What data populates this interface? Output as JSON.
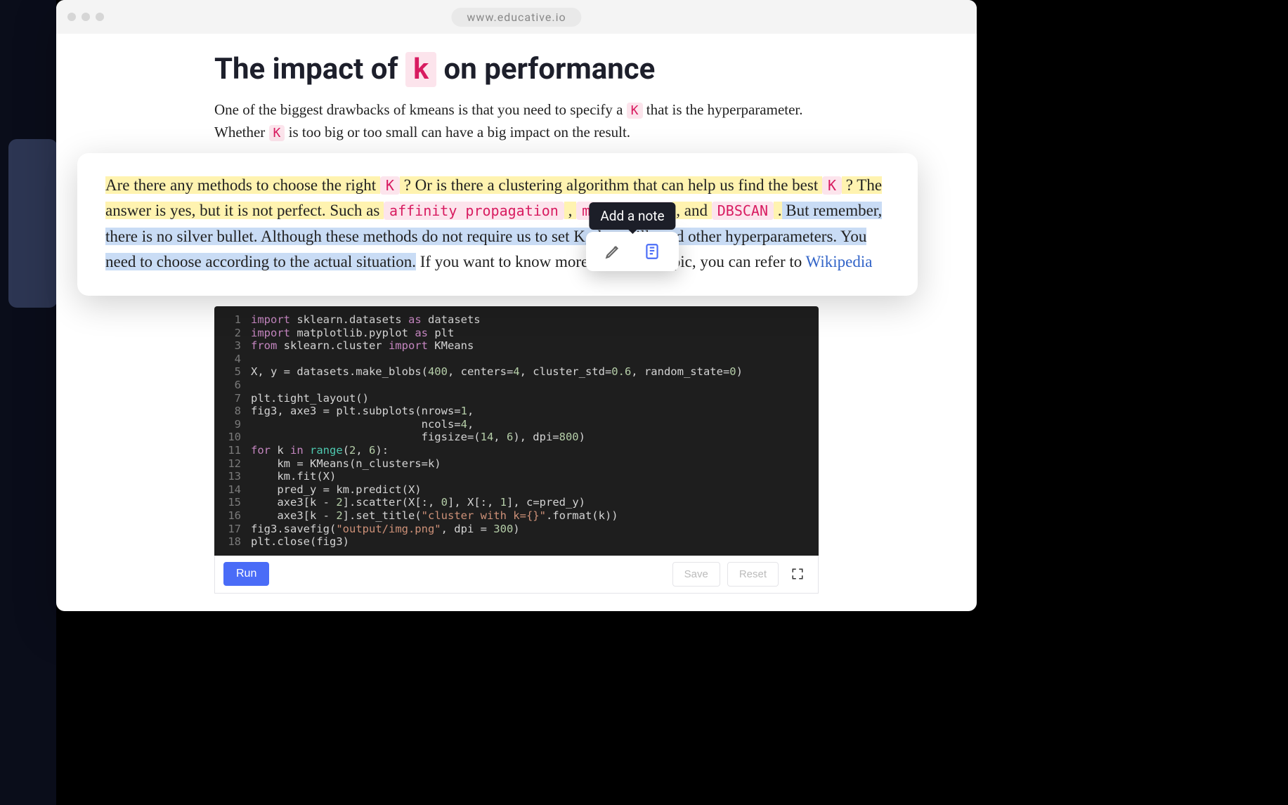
{
  "browser": {
    "url": "www.educative.io"
  },
  "heading": {
    "pre": "The impact of ",
    "code": "k",
    "post": " on performance"
  },
  "para1": {
    "t1": "One of the biggest drawbacks of kmeans is that you need to specify a ",
    "k1": "K",
    "t2": " that is the hyperparameter. Whether ",
    "k2": "K",
    "t3": " is too big or too small can have a big impact on the result."
  },
  "float": {
    "y1": "Are there any methods to choose the right ",
    "kA": "K",
    "y2": " ? Or is there a clustering algorithm that can help us find the best ",
    "kB": "K",
    "y3": " ? The answer is yes, but it is not perfect. Such as ",
    "c1": "affinity propagation",
    "y4": " , ",
    "c2": "mean shift",
    "y5": " , and ",
    "c3": "DBSCAN",
    "y6": " .",
    "b1": " But remember, there is no silver bullet. Although these methods do not require us to set K, they still need other hyperparameters. You need to choose according to the actual situation.",
    "n1": " If you want to know more about this topic, you can refer to ",
    "link": "Wikipedia"
  },
  "tooltip": {
    "label": "Add a note"
  },
  "code": {
    "lines": [
      {
        "n": 1,
        "seg": [
          [
            "kw",
            "import"
          ],
          [
            "",
            " sklearn.datasets "
          ],
          [
            "as",
            "as"
          ],
          [
            "",
            " datasets"
          ]
        ]
      },
      {
        "n": 2,
        "seg": [
          [
            "kw",
            "import"
          ],
          [
            "",
            " matplotlib.pyplot "
          ],
          [
            "as",
            "as"
          ],
          [
            "",
            " plt"
          ]
        ]
      },
      {
        "n": 3,
        "seg": [
          [
            "kw",
            "from"
          ],
          [
            "",
            " sklearn.cluster "
          ],
          [
            "kw",
            "import"
          ],
          [
            "",
            " KMeans"
          ]
        ]
      },
      {
        "n": 4,
        "seg": [
          [
            "",
            ""
          ]
        ]
      },
      {
        "n": 5,
        "seg": [
          [
            "",
            "X, y = datasets.make_blobs("
          ],
          [
            "num",
            "400"
          ],
          [
            "",
            ", centers="
          ],
          [
            "num",
            "4"
          ],
          [
            "",
            ", cluster_std="
          ],
          [
            "num",
            "0.6"
          ],
          [
            "",
            ", random_state="
          ],
          [
            "num",
            "0"
          ],
          [
            "",
            ")"
          ]
        ]
      },
      {
        "n": 6,
        "seg": [
          [
            "",
            ""
          ]
        ]
      },
      {
        "n": 7,
        "seg": [
          [
            "",
            "plt.tight_layout()"
          ]
        ]
      },
      {
        "n": 8,
        "seg": [
          [
            "",
            "fig3, axe3 = plt.subplots(nrows="
          ],
          [
            "num",
            "1"
          ],
          [
            "",
            ","
          ]
        ]
      },
      {
        "n": 9,
        "seg": [
          [
            "",
            "                          ncols="
          ],
          [
            "num",
            "4"
          ],
          [
            "",
            ","
          ]
        ]
      },
      {
        "n": 10,
        "seg": [
          [
            "",
            "                          figsize=("
          ],
          [
            "num",
            "14"
          ],
          [
            "",
            ", "
          ],
          [
            "num",
            "6"
          ],
          [
            "",
            "), dpi="
          ],
          [
            "num",
            "800"
          ],
          [
            "",
            ")"
          ]
        ]
      },
      {
        "n": 11,
        "seg": [
          [
            "kw",
            "for"
          ],
          [
            "",
            " k "
          ],
          [
            "kw",
            "in"
          ],
          [
            "",
            " "
          ],
          [
            "builtin",
            "range"
          ],
          [
            "",
            "("
          ],
          [
            "num",
            "2"
          ],
          [
            "",
            ", "
          ],
          [
            "num",
            "6"
          ],
          [
            "",
            "):"
          ]
        ]
      },
      {
        "n": 12,
        "seg": [
          [
            "",
            "    km = KMeans(n_clusters=k)"
          ]
        ]
      },
      {
        "n": 13,
        "seg": [
          [
            "",
            "    km.fit(X)"
          ]
        ]
      },
      {
        "n": 14,
        "seg": [
          [
            "",
            "    pred_y = km.predict(X)"
          ]
        ]
      },
      {
        "n": 15,
        "seg": [
          [
            "",
            "    axe3[k - "
          ],
          [
            "num",
            "2"
          ],
          [
            "",
            "].scatter(X[:, "
          ],
          [
            "num",
            "0"
          ],
          [
            "",
            "], X[:, "
          ],
          [
            "num",
            "1"
          ],
          [
            "",
            "], c=pred_y)"
          ]
        ]
      },
      {
        "n": 16,
        "seg": [
          [
            "",
            "    axe3[k - "
          ],
          [
            "num",
            "2"
          ],
          [
            "",
            "].set_title("
          ],
          [
            "str",
            "\"cluster with k={}\""
          ],
          [
            "",
            ".format(k))"
          ]
        ]
      },
      {
        "n": 17,
        "seg": [
          [
            "",
            "fig3.savefig("
          ],
          [
            "str",
            "\"output/img.png\""
          ],
          [
            "",
            ", dpi = "
          ],
          [
            "num",
            "300"
          ],
          [
            "",
            ")"
          ]
        ]
      },
      {
        "n": 18,
        "seg": [
          [
            "",
            "plt.close(fig3)"
          ]
        ]
      }
    ]
  },
  "toolbar": {
    "run": "Run",
    "save": "Save",
    "reset": "Reset"
  }
}
